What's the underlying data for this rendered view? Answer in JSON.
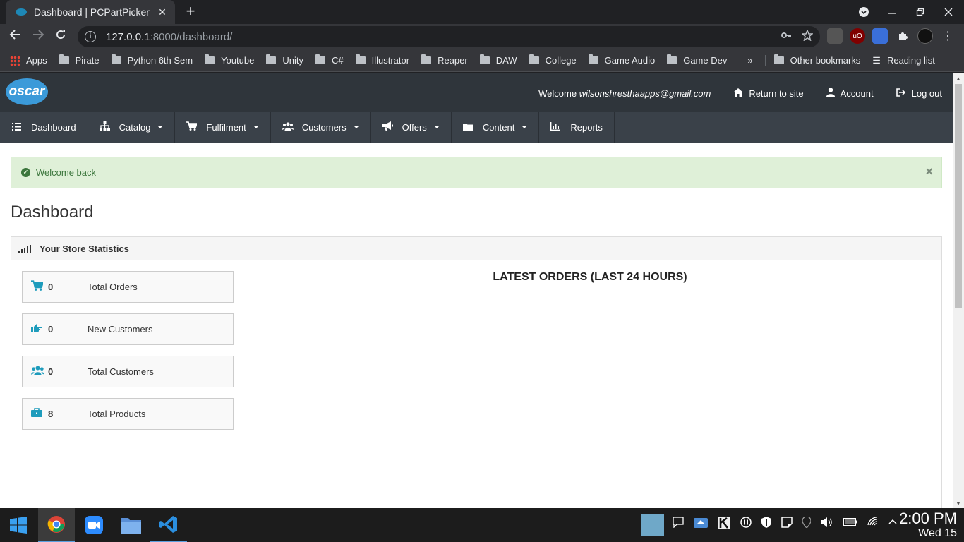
{
  "browser": {
    "tab_title": "Dashboard | PCPartPicker",
    "tab_close": "✕",
    "new_tab": "+",
    "url_host": "127.0.0.1",
    "url_path": ":8000/dashboard/",
    "bookmarks": [
      "Apps",
      "Pirate",
      "Python 6th Sem",
      "Youtube",
      "Unity",
      "C#",
      "Illustrator",
      "Reaper",
      "DAW",
      "College",
      "Game Audio",
      "Game Dev"
    ],
    "more_bookmarks": "»",
    "other_bookmarks": "Other bookmarks",
    "reading_list": "Reading list"
  },
  "header": {
    "logo": "oscar",
    "welcome_prefix": "Welcome",
    "user_email": "wilsonshresthaapps@gmail.com",
    "return_to_site": "Return to site",
    "account": "Account",
    "logout": "Log out"
  },
  "nav": [
    {
      "label": "Dashboard",
      "icon": "list-icon",
      "dropdown": false
    },
    {
      "label": "Catalog",
      "icon": "sitemap-icon",
      "dropdown": true
    },
    {
      "label": "Fulfilment",
      "icon": "cart-icon",
      "dropdown": true
    },
    {
      "label": "Customers",
      "icon": "users-icon",
      "dropdown": true
    },
    {
      "label": "Offers",
      "icon": "bullhorn-icon",
      "dropdown": true
    },
    {
      "label": "Content",
      "icon": "folder-icon",
      "dropdown": true
    },
    {
      "label": "Reports",
      "icon": "bar-chart-icon",
      "dropdown": false
    }
  ],
  "alert": {
    "message": "Welcome back",
    "close": "×"
  },
  "page_title": "Dashboard",
  "stats_panel": {
    "title": "Your Store Statistics",
    "stats": [
      {
        "value": "0",
        "label": "Total Orders",
        "icon": "cart-icon"
      },
      {
        "value": "0",
        "label": "New Customers",
        "icon": "hand-point-icon"
      },
      {
        "value": "0",
        "label": "Total Customers",
        "icon": "users-icon"
      },
      {
        "value": "8",
        "label": "Total Products",
        "icon": "briefcase-icon"
      }
    ],
    "latest_orders_title": "LATEST ORDERS (LAST 24 HOURS)"
  },
  "taskbar": {
    "time": "2:00 PM",
    "date": "Wed 15"
  },
  "colors": {
    "accent": "#1e9cbc",
    "header_bg": "#2f353b",
    "nav_bg": "#3a4149",
    "alert_bg": "#dff0d8"
  }
}
